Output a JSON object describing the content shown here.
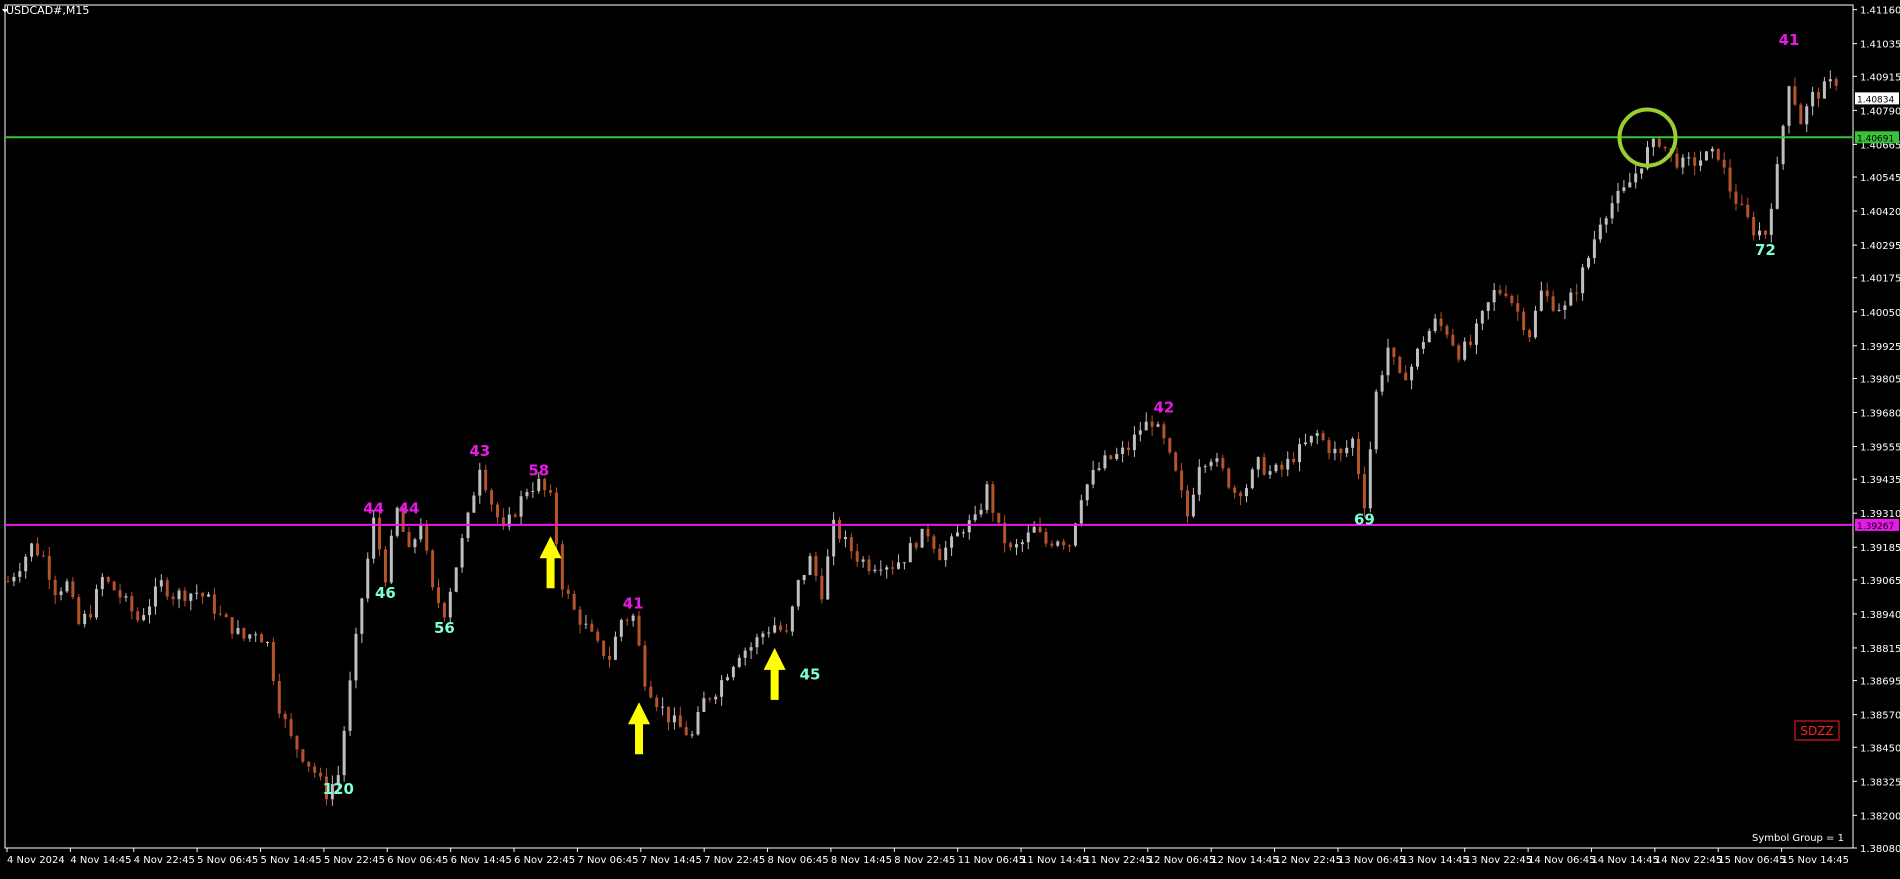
{
  "window": {
    "symbol_title": "USDCAD#,M15",
    "badge": "SDZZ",
    "footer_note": "Symbol Group = 1"
  },
  "colors": {
    "background": "#000000",
    "bull": "#bfbfbf",
    "bear": "#b5532a",
    "axis": "#ffffff",
    "green_line": "#37c337",
    "magenta_line": "#e619e6",
    "peak_label": "#e619e6",
    "trough_label": "#7fffd4",
    "arrow": "#ffff00",
    "circle": "#9acd32",
    "badge_border": "#ff2020"
  },
  "chart_data": {
    "type": "candlestick",
    "timeframe": "M15",
    "ylim": [
      1.3808,
      1.41177
    ],
    "y_ticks": [
      "1.41160",
      "1.41035",
      "1.40915",
      "1.40790",
      "1.40665",
      "1.40545",
      "1.40420",
      "1.40295",
      "1.40175",
      "1.40050",
      "1.39925",
      "1.39805",
      "1.39680",
      "1.39555",
      "1.39435",
      "1.39310",
      "1.39185",
      "1.39065",
      "1.38940",
      "1.38815",
      "1.38695",
      "1.38570",
      "1.38450",
      "1.38325",
      "1.38200",
      "1.38080"
    ],
    "x_ticks": [
      "4 Nov 2024",
      "4 Nov 14:45",
      "4 Nov 22:45",
      "5 Nov 06:45",
      "5 Nov 14:45",
      "5 Nov 22:45",
      "6 Nov 06:45",
      "6 Nov 14:45",
      "6 Nov 22:45",
      "7 Nov 06:45",
      "7 Nov 14:45",
      "7 Nov 22:45",
      "8 Nov 06:45",
      "8 Nov 14:45",
      "8 Nov 22:45",
      "11 Nov 06:45",
      "11 Nov 14:45",
      "11 Nov 22:45",
      "12 Nov 06:45",
      "12 Nov 14:45",
      "12 Nov 22:45",
      "13 Nov 06:45",
      "13 Nov 14:45",
      "13 Nov 22:45",
      "14 Nov 06:45",
      "14 Nov 14:45",
      "14 Nov 22:45",
      "15 Nov 06:45",
      "15 Nov 14:45"
    ],
    "path_points": [
      [
        0,
        1.3906
      ],
      [
        2,
        1.3912
      ],
      [
        4,
        1.3919
      ],
      [
        6,
        1.3915
      ],
      [
        8,
        1.3903
      ],
      [
        10,
        1.3905
      ],
      [
        12,
        1.389
      ],
      [
        14,
        1.3895
      ],
      [
        16,
        1.3907
      ],
      [
        18,
        1.3903
      ],
      [
        20,
        1.3898
      ],
      [
        22,
        1.3892
      ],
      [
        24,
        1.3898
      ],
      [
        26,
        1.3905
      ],
      [
        28,
        1.3901
      ],
      [
        32,
        1.3902
      ],
      [
        34,
        1.3899
      ],
      [
        36,
        1.3893
      ],
      [
        38,
        1.3889
      ],
      [
        40,
        1.3885
      ],
      [
        42,
        1.3888
      ],
      [
        44,
        1.3883
      ],
      [
        46,
        1.386
      ],
      [
        48,
        1.3848
      ],
      [
        50,
        1.3842
      ],
      [
        52,
        1.3836
      ],
      [
        54,
        1.3828
      ],
      [
        56,
        1.3835
      ],
      [
        58,
        1.3868
      ],
      [
        60,
        1.39
      ],
      [
        62,
        1.3928
      ],
      [
        64,
        1.3908
      ],
      [
        66,
        1.3932
      ],
      [
        68,
        1.3916
      ],
      [
        70,
        1.3928
      ],
      [
        72,
        1.3902
      ],
      [
        74,
        1.3895
      ],
      [
        76,
        1.3912
      ],
      [
        78,
        1.3929
      ],
      [
        80,
        1.3949
      ],
      [
        82,
        1.3935
      ],
      [
        84,
        1.3924
      ],
      [
        86,
        1.3932
      ],
      [
        88,
        1.394
      ],
      [
        90,
        1.3942
      ],
      [
        92,
        1.3936
      ],
      [
        94,
        1.3905
      ],
      [
        96,
        1.3895
      ],
      [
        98,
        1.3889
      ],
      [
        100,
        1.3882
      ],
      [
        102,
        1.3878
      ],
      [
        104,
        1.3892
      ],
      [
        106,
        1.3893
      ],
      [
        108,
        1.387
      ],
      [
        110,
        1.3862
      ],
      [
        112,
        1.3856
      ],
      [
        114,
        1.3852
      ],
      [
        116,
        1.3849
      ],
      [
        118,
        1.3862
      ],
      [
        120,
        1.3866
      ],
      [
        122,
        1.3873
      ],
      [
        124,
        1.388
      ],
      [
        126,
        1.3882
      ],
      [
        128,
        1.3887
      ],
      [
        130,
        1.389
      ],
      [
        132,
        1.3886
      ],
      [
        134,
        1.3905
      ],
      [
        136,
        1.3914
      ],
      [
        138,
        1.3902
      ],
      [
        140,
        1.3926
      ],
      [
        142,
        1.392
      ],
      [
        144,
        1.3915
      ],
      [
        146,
        1.3912
      ],
      [
        148,
        1.3913
      ],
      [
        150,
        1.3912
      ],
      [
        152,
        1.3915
      ],
      [
        154,
        1.3921
      ],
      [
        156,
        1.3924
      ],
      [
        158,
        1.3916
      ],
      [
        160,
        1.392
      ],
      [
        162,
        1.3926
      ],
      [
        164,
        1.3928
      ],
      [
        166,
        1.394
      ],
      [
        168,
        1.3925
      ],
      [
        170,
        1.3917
      ],
      [
        172,
        1.392
      ],
      [
        174,
        1.3925
      ],
      [
        176,
        1.392
      ],
      [
        178,
        1.3922
      ],
      [
        180,
        1.392
      ],
      [
        182,
        1.3938
      ],
      [
        184,
        1.3945
      ],
      [
        186,
        1.395
      ],
      [
        188,
        1.3952
      ],
      [
        190,
        1.3955
      ],
      [
        192,
        1.3962
      ],
      [
        194,
        1.3965
      ],
      [
        196,
        1.3957
      ],
      [
        198,
        1.3945
      ],
      [
        200,
        1.393
      ],
      [
        202,
        1.395
      ],
      [
        204,
        1.3952
      ],
      [
        206,
        1.3946
      ],
      [
        208,
        1.3939
      ],
      [
        210,
        1.3941
      ],
      [
        212,
        1.3949
      ],
      [
        214,
        1.3946
      ],
      [
        216,
        1.3947
      ],
      [
        218,
        1.3952
      ],
      [
        220,
        1.3956
      ],
      [
        222,
        1.396
      ],
      [
        224,
        1.3955
      ],
      [
        226,
        1.3952
      ],
      [
        228,
        1.3958
      ],
      [
        230,
        1.3935
      ],
      [
        232,
        1.3975
      ],
      [
        234,
        1.3992
      ],
      [
        236,
        1.398
      ],
      [
        238,
        1.3985
      ],
      [
        240,
        1.3995
      ],
      [
        242,
        1.4001
      ],
      [
        244,
        1.3998
      ],
      [
        246,
        1.399
      ],
      [
        248,
        1.3993
      ],
      [
        250,
        1.4003
      ],
      [
        252,
        1.4012
      ],
      [
        254,
        1.4013
      ],
      [
        256,
        1.4005
      ],
      [
        258,
        1.3997
      ],
      [
        260,
        1.4012
      ],
      [
        262,
        1.4008
      ],
      [
        264,
        1.4006
      ],
      [
        266,
        1.4014
      ],
      [
        268,
        1.4025
      ],
      [
        270,
        1.4039
      ],
      [
        272,
        1.4045
      ],
      [
        274,
        1.4049
      ],
      [
        276,
        1.4056
      ],
      [
        278,
        1.4064
      ],
      [
        280,
        1.4068
      ],
      [
        282,
        1.4062
      ],
      [
        284,
        1.4059
      ],
      [
        286,
        1.406
      ],
      [
        288,
        1.4062
      ],
      [
        290,
        1.4063
      ],
      [
        292,
        1.405
      ],
      [
        294,
        1.4042
      ],
      [
        296,
        1.4035
      ],
      [
        298,
        1.4034
      ],
      [
        300,
        1.4057
      ],
      [
        302,
        1.409
      ],
      [
        304,
        1.4075
      ],
      [
        306,
        1.4084
      ],
      [
        308,
        1.4087
      ],
      [
        310,
        1.409
      ]
    ],
    "pivots": [
      {
        "text": "120",
        "bar": 56,
        "price": 1.3836,
        "kind": "low"
      },
      {
        "text": "44",
        "bar": 62,
        "price": 1.3928,
        "kind": "high"
      },
      {
        "text": "46",
        "bar": 64,
        "price": 1.3908,
        "kind": "low"
      },
      {
        "text": "44",
        "bar": 68,
        "price": 1.3928,
        "kind": "high"
      },
      {
        "text": "56",
        "bar": 74,
        "price": 1.3895,
        "kind": "low"
      },
      {
        "text": "43",
        "bar": 80,
        "price": 1.3949,
        "kind": "high"
      },
      {
        "text": "58",
        "bar": 90,
        "price": 1.3942,
        "kind": "high"
      },
      {
        "text": "41",
        "bar": 106,
        "price": 1.3893,
        "kind": "high"
      },
      {
        "text": "45",
        "bar": 136,
        "price": 1.3878,
        "kind": "low"
      },
      {
        "text": "42",
        "bar": 196,
        "price": 1.3965,
        "kind": "high"
      },
      {
        "text": "69",
        "bar": 230,
        "price": 1.3935,
        "kind": "low"
      },
      {
        "text": "72",
        "bar": 298,
        "price": 1.4034,
        "kind": "low"
      },
      {
        "text": "41",
        "bar": 302,
        "price": 1.41,
        "kind": "high"
      }
    ],
    "horizontal_lines": [
      {
        "name": "resistance",
        "price": 1.40691,
        "label": "1.40691",
        "color_key": "green_line"
      },
      {
        "name": "support",
        "price": 1.39267,
        "label": "1.39267",
        "color_key": "magenta_line"
      }
    ],
    "current_price": {
      "price": 1.40834,
      "label": "1.40834"
    },
    "arrows": [
      {
        "bar": 92,
        "price": 1.3924,
        "direction": "up"
      },
      {
        "bar": 107,
        "price": 1.3863,
        "direction": "up"
      },
      {
        "bar": 130,
        "price": 1.3883,
        "direction": "up"
      }
    ],
    "circle": {
      "bar": 278,
      "price": 1.4069
    }
  }
}
